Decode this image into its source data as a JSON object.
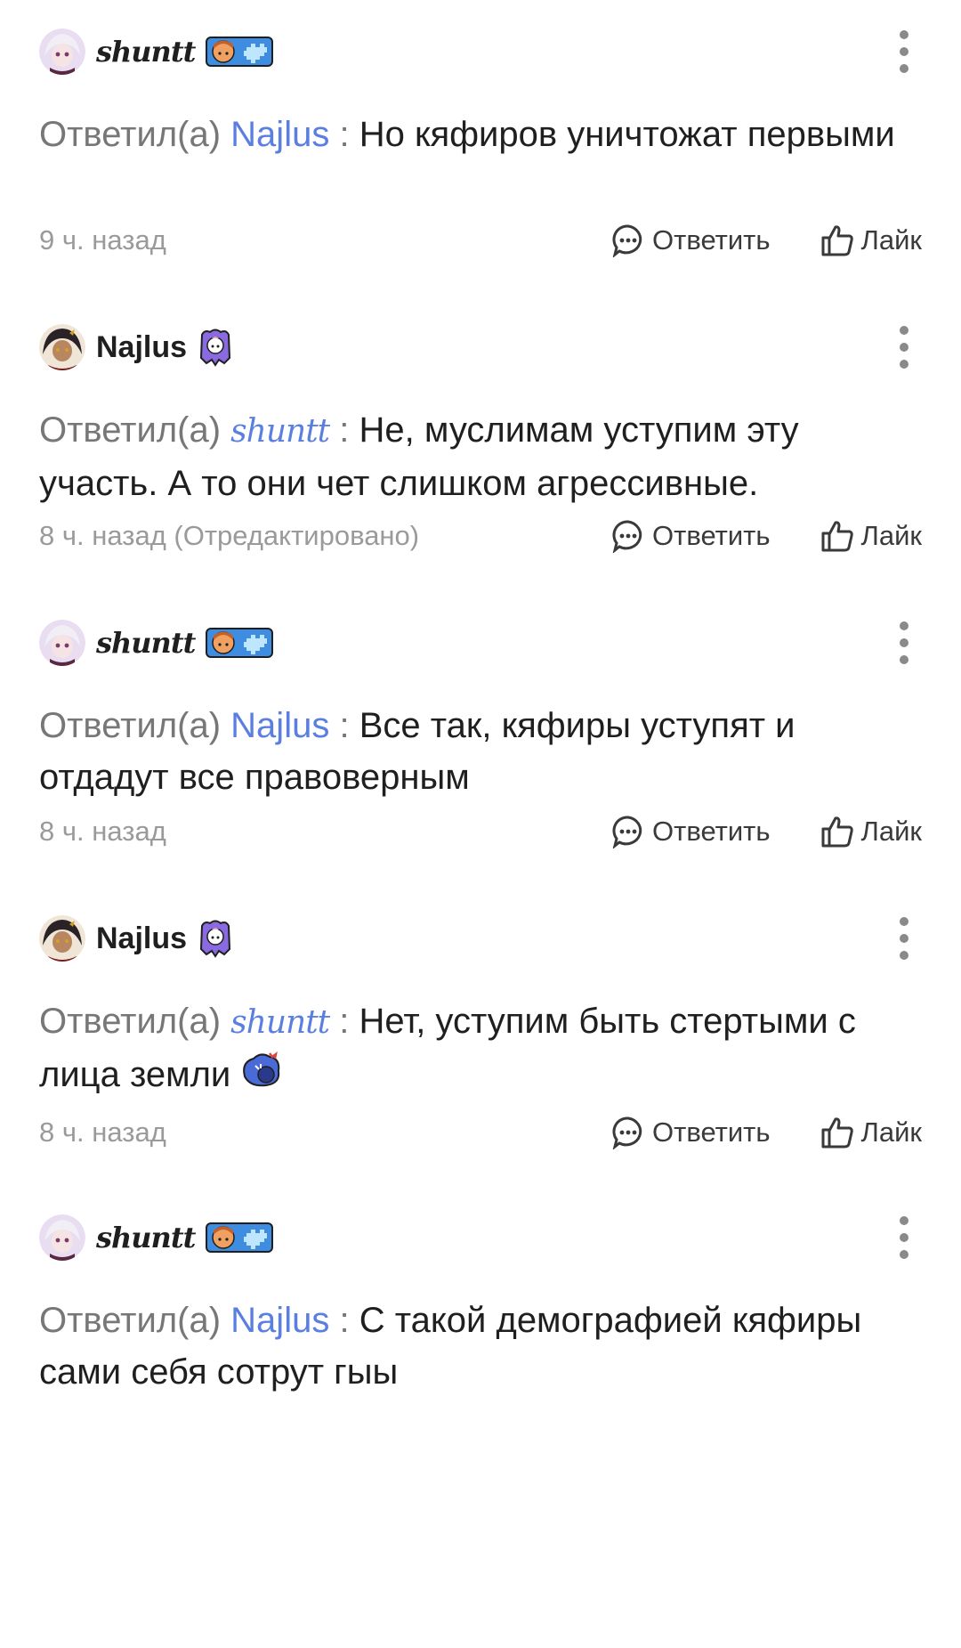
{
  "comments": [
    {
      "author": "shuntt",
      "reply_prefix": "Ответил(а)",
      "mention": "Najlus",
      "separator": ":",
      "text": "Но кяфиров уничтожат первыми",
      "time": "9 ч. назад",
      "reply_label": "Ответить",
      "like_label": "Лайк"
    },
    {
      "author": "Najlus",
      "reply_prefix": "Ответил(а)",
      "mention": "shuntt",
      "separator": ":",
      "text": "Не, муслимам уступим эту участь. А то они чет слишком агрессивные.",
      "time": "8 ч. назад (Отредактировано)",
      "reply_label": "Ответить",
      "like_label": "Лайк"
    },
    {
      "author": "shuntt",
      "reply_prefix": "Ответил(а)",
      "mention": "Najlus",
      "separator": ":",
      "text": "Все так, кяфиры уступят и отдадут все правоверным",
      "time": "8 ч. назад",
      "reply_label": "Ответить",
      "like_label": "Лайк"
    },
    {
      "author": "Najlus",
      "reply_prefix": "Ответил(а)",
      "mention": "shuntt",
      "separator": ":",
      "text": "Нет, уступим быть стертыми с лица земли",
      "time": "8 ч. назад",
      "reply_label": "Ответить",
      "like_label": "Лайк"
    },
    {
      "author": "shuntt",
      "reply_prefix": "Ответил(а)",
      "mention": "Najlus",
      "separator": ":",
      "text": "С такой демографией кяфиры сами себя сотрут гыы"
    }
  ],
  "colors": {
    "mention": "#5b7fe0",
    "muted": "#777777",
    "time": "#9a9a9a",
    "more_dots": "#8a8a8a"
  },
  "icons": {
    "reply": "speech-bubble-icon",
    "like": "thumbs-up-icon",
    "more": "vertical-dots-icon"
  }
}
